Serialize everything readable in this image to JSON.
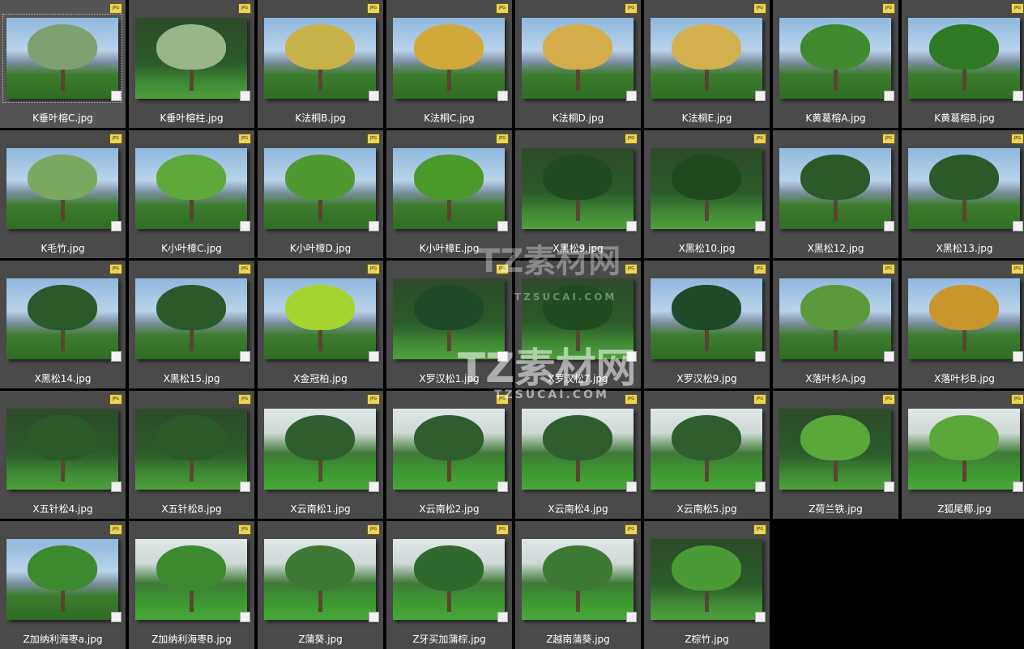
{
  "colors": {
    "panel": "#4a4a4a",
    "background": "#000000",
    "caption": "#ffffff",
    "badge": "#e9d55a"
  },
  "file_badge": "JPG",
  "watermark": {
    "line1": "TZ素材网",
    "line2": "TZSUCAI.COM"
  },
  "files": [
    {
      "name": "K垂叶榕C.jpg",
      "selected": true,
      "theme": "sky",
      "crown": "#7fa070"
    },
    {
      "name": "K垂叶榕柱.jpg",
      "theme": "dark",
      "crown": "#9ab58a"
    },
    {
      "name": "K法桐B.jpg",
      "theme": "sky",
      "crown": "#c9b14a"
    },
    {
      "name": "K法桐C.jpg",
      "theme": "sky",
      "crown": "#d1a93a"
    },
    {
      "name": "K法桐D.jpg",
      "theme": "sky",
      "crown": "#d4ad4a"
    },
    {
      "name": "K法桐E.jpg",
      "theme": "sky",
      "crown": "#d2b050"
    },
    {
      "name": "K黄葛榕A.jpg",
      "theme": "sky",
      "crown": "#3f8a2e"
    },
    {
      "name": "K黄葛榕B.jpg",
      "theme": "sky",
      "crown": "#2f7a24"
    },
    {
      "name": "K毛竹.jpg",
      "theme": "sky",
      "crown": "#7aa860"
    },
    {
      "name": "K小叶樟C.jpg",
      "theme": "sky",
      "crown": "#5fa83a"
    },
    {
      "name": "K小叶樟D.jpg",
      "theme": "sky",
      "crown": "#4e9a30"
    },
    {
      "name": "K小叶樟E.jpg",
      "theme": "sky",
      "crown": "#4a9a2c"
    },
    {
      "name": "X黑松9.jpg",
      "theme": "dark",
      "crown": "#204a22"
    },
    {
      "name": "X黑松10.jpg",
      "theme": "dark",
      "crown": "#1f4a20"
    },
    {
      "name": "X黑松12.jpg",
      "theme": "sky",
      "crown": "#2a5a2a"
    },
    {
      "name": "X黑松13.jpg",
      "theme": "sky",
      "crown": "#2a5a2a"
    },
    {
      "name": "X黑松14.jpg",
      "theme": "sky",
      "crown": "#2a5a2a"
    },
    {
      "name": "X黑松15.jpg",
      "theme": "sky",
      "crown": "#2a5a2a"
    },
    {
      "name": "X金冠柏.jpg",
      "theme": "sky",
      "crown": "#a6d430"
    },
    {
      "name": "X罗汉松1.jpg",
      "theme": "dark",
      "crown": "#1f4a2a"
    },
    {
      "name": "X罗汉松7.jpg",
      "theme": "dark",
      "crown": "#1f4a22"
    },
    {
      "name": "X罗汉松9.jpg",
      "theme": "sky",
      "crown": "#1f4a28"
    },
    {
      "name": "X落叶杉A.jpg",
      "theme": "sky",
      "crown": "#5a9a3a"
    },
    {
      "name": "X落叶杉B.jpg",
      "theme": "sky",
      "crown": "#c9962e"
    },
    {
      "name": "X五针松4.jpg",
      "theme": "dark",
      "crown": "#2a5a2a"
    },
    {
      "name": "X五针松8.jpg",
      "theme": "dark",
      "crown": "#2a5a2a"
    },
    {
      "name": "X云南松1.jpg",
      "theme": "grass",
      "crown": "#2e5e2e"
    },
    {
      "name": "X云南松2.jpg",
      "theme": "grass",
      "crown": "#2e5e2e"
    },
    {
      "name": "X云南松4.jpg",
      "theme": "grass",
      "crown": "#2e5e2e"
    },
    {
      "name": "X云南松5.jpg",
      "theme": "grass",
      "crown": "#2e5e2e"
    },
    {
      "name": "Z荷兰铁.jpg",
      "theme": "dark",
      "crown": "#5aa83a"
    },
    {
      "name": "Z狐尾椰.jpg",
      "theme": "grass",
      "crown": "#5aa83a"
    },
    {
      "name": "Z加纳利海枣a.jpg",
      "theme": "sky",
      "crown": "#3c8a2e"
    },
    {
      "name": "Z加纳利海枣B.jpg",
      "theme": "grass",
      "crown": "#3c8a2e"
    },
    {
      "name": "Z蒲葵.jpg",
      "theme": "grass",
      "crown": "#3c7a34"
    },
    {
      "name": "Z牙买加蒲棕.jpg",
      "theme": "grass",
      "crown": "#2e6a2e"
    },
    {
      "name": "Z越南蒲葵.jpg",
      "theme": "grass",
      "crown": "#3c7a34"
    },
    {
      "name": "Z棕竹.jpg",
      "theme": "dark",
      "crown": "#4a9a36"
    }
  ]
}
